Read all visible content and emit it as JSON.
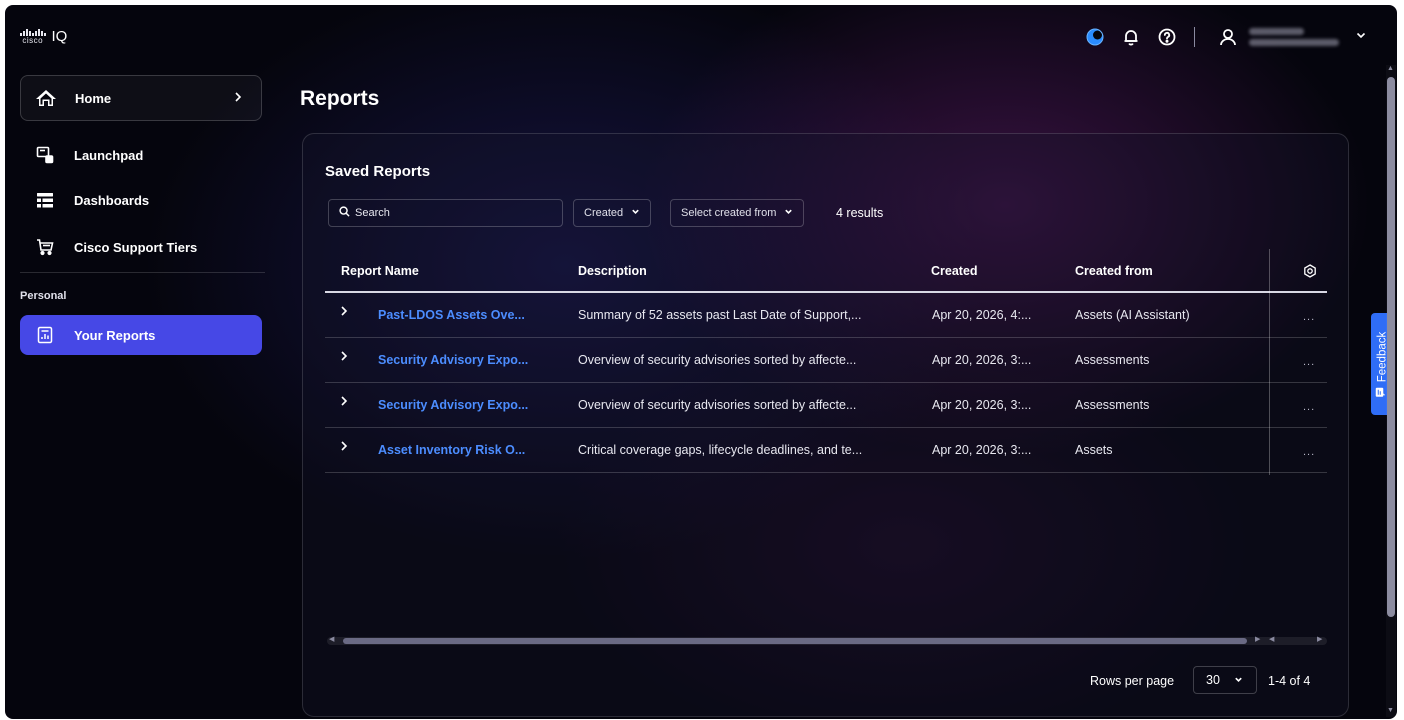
{
  "app": {
    "logo_text": "cisco",
    "product": "IQ"
  },
  "header": {
    "icons": [
      "theme-toggle-icon",
      "bell-icon",
      "help-icon",
      "user-icon",
      "chevron-down-icon"
    ]
  },
  "sidebar": {
    "items": [
      {
        "label": "Home",
        "icon": "home-icon"
      },
      {
        "label": "Launchpad",
        "icon": "launchpad-icon"
      },
      {
        "label": "Dashboards",
        "icon": "dashboards-icon"
      },
      {
        "label": "Cisco Support Tiers",
        "icon": "cart-icon"
      }
    ],
    "section_label": "Personal",
    "personal_items": [
      {
        "label": "Your Reports",
        "icon": "report-icon"
      }
    ]
  },
  "page": {
    "title": "Reports"
  },
  "saved_reports": {
    "title": "Saved Reports",
    "search_placeholder": "Search",
    "filter_created": "Created",
    "filter_created_from": "Select created from",
    "results_count": "4 results",
    "columns": [
      "Report Name",
      "Description",
      "Created",
      "Created from"
    ],
    "rows": [
      {
        "name": "Past-LDOS Assets Ove...",
        "description": "Summary of 52 assets past Last Date of Support,...",
        "created": "Apr 20, 2026, 4:...",
        "created_from": "Assets (AI Assistant)",
        "more": "..."
      },
      {
        "name": "Security Advisory Expo...",
        "description": "Overview of security advisories sorted by affecte...",
        "created": "Apr 20, 2026, 3:...",
        "created_from": "Assessments",
        "more": "..."
      },
      {
        "name": "Security Advisory Expo...",
        "description": "Overview of security advisories sorted by affecte...",
        "created": "Apr 20, 2026, 3:...",
        "created_from": "Assessments",
        "more": "..."
      },
      {
        "name": "Asset Inventory Risk O...",
        "description": "Critical coverage gaps, lifecycle deadlines, and te...",
        "created": "Apr 20, 2026, 3:...",
        "created_from": "Assets",
        "more": "..."
      }
    ],
    "pagination": {
      "rows_per_page_label": "Rows per page",
      "rows_per_page_value": "30",
      "range": "1-4 of 4"
    }
  },
  "feedback": {
    "label": "Feedback"
  },
  "colors": {
    "accent": "#4648e6",
    "link": "#4c8dff",
    "feedback": "#2f6df6",
    "background": "#05050d"
  }
}
